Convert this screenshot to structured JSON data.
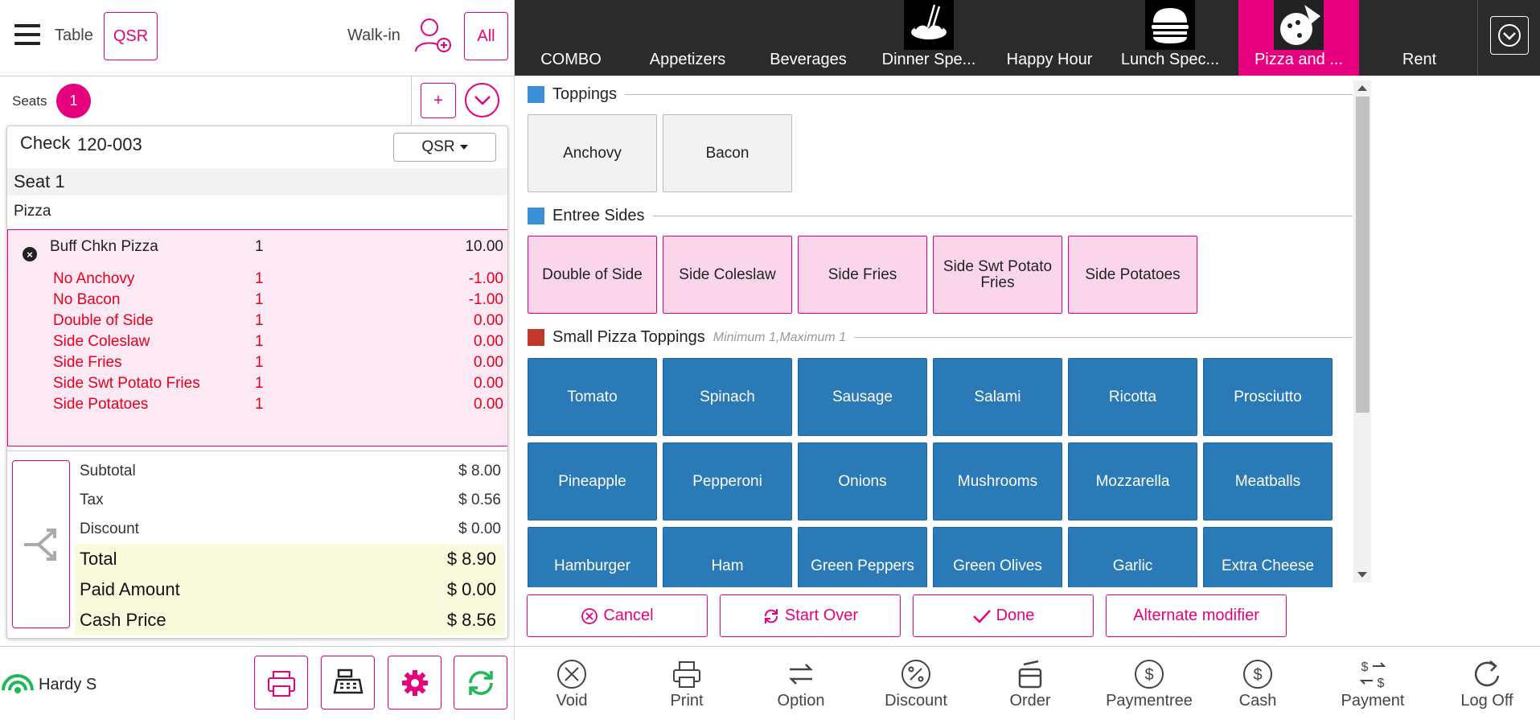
{
  "header": {
    "table_label": "Table",
    "order_type_button": "QSR",
    "walkin_label": "Walk-in",
    "all_button": "All"
  },
  "seats": {
    "label": "Seats",
    "count": "1",
    "add_label": "+"
  },
  "check": {
    "label": "Check",
    "number": "120-003",
    "order_type": "QSR",
    "seat_header": "Seat 1",
    "category": "Pizza",
    "item": {
      "name": "Buff Chkn Pizza",
      "qty": "1",
      "price": "10.00"
    },
    "modifiers": [
      {
        "name": "No Anchovy",
        "qty": "1",
        "price": "-1.00"
      },
      {
        "name": "No Bacon",
        "qty": "1",
        "price": "-1.00"
      },
      {
        "name": "Double of Side",
        "qty": "1",
        "price": "0.00"
      },
      {
        "name": "Side Coleslaw",
        "qty": "1",
        "price": "0.00"
      },
      {
        "name": "Side Fries",
        "qty": "1",
        "price": "0.00"
      },
      {
        "name": "Side Swt Potato Fries",
        "qty": "1",
        "price": "0.00"
      },
      {
        "name": "Side Potatoes",
        "qty": "1",
        "price": "0.00"
      }
    ],
    "summary": {
      "subtotal_label": "Subtotal",
      "subtotal": "$ 8.00",
      "tax_label": "Tax",
      "tax": "$ 0.56",
      "discount_label": "Discount",
      "discount": "$ 0.00",
      "total_label": "Total",
      "total": "$ 8.90",
      "paid_label": "Paid Amount",
      "paid": "$ 0.00",
      "cash_label": "Cash Price",
      "cash": "$ 8.56"
    }
  },
  "footer_left": {
    "user": "Hardy S"
  },
  "categories": [
    {
      "label": "COMBO"
    },
    {
      "label": "Appetizers"
    },
    {
      "label": "Beverages"
    },
    {
      "label": "Dinner Spe..."
    },
    {
      "label": "Happy Hour"
    },
    {
      "label": "Lunch Spec..."
    },
    {
      "label": "Pizza and ..."
    },
    {
      "label": "Rent"
    }
  ],
  "sections": {
    "toppings": {
      "title": "Toppings",
      "items": [
        "Anchovy",
        "Bacon"
      ]
    },
    "sides": {
      "title": "Entree Sides",
      "items": [
        "Double of Side",
        "Side Coleslaw",
        "Side Fries",
        "Side Swt Potato Fries",
        "Side Potatoes"
      ]
    },
    "small": {
      "title": "Small Pizza Toppings",
      "hint": "Minimum 1,Maximum 1",
      "items": [
        "Tomato",
        "Spinach",
        "Sausage",
        "Salami",
        "Ricotta",
        "Prosciutto",
        "Pineapple",
        "Pepperoni",
        "Onions",
        "Mushrooms",
        "Mozzarella",
        "Meatballs",
        "Hamburger",
        "Ham",
        "Green Peppers",
        "Green Olives",
        "Garlic",
        "Extra Cheese"
      ]
    }
  },
  "actions": {
    "cancel": "Cancel",
    "start_over": "Start Over",
    "done": "Done",
    "alternate": "Alternate modifier"
  },
  "toolbar": {
    "void": "Void",
    "print": "Print",
    "option": "Option",
    "discount": "Discount",
    "order": "Order",
    "paymentree": "Paymentree",
    "cash": "Cash",
    "payment": "Payment",
    "logoff": "Log Off"
  },
  "colors": {
    "accent": "#e6007e",
    "topping_square": "#3a8fd6",
    "required_square": "#c0392b",
    "modifier_blue": "#2a7ab8",
    "modifier_text_red": "#e8001c"
  }
}
